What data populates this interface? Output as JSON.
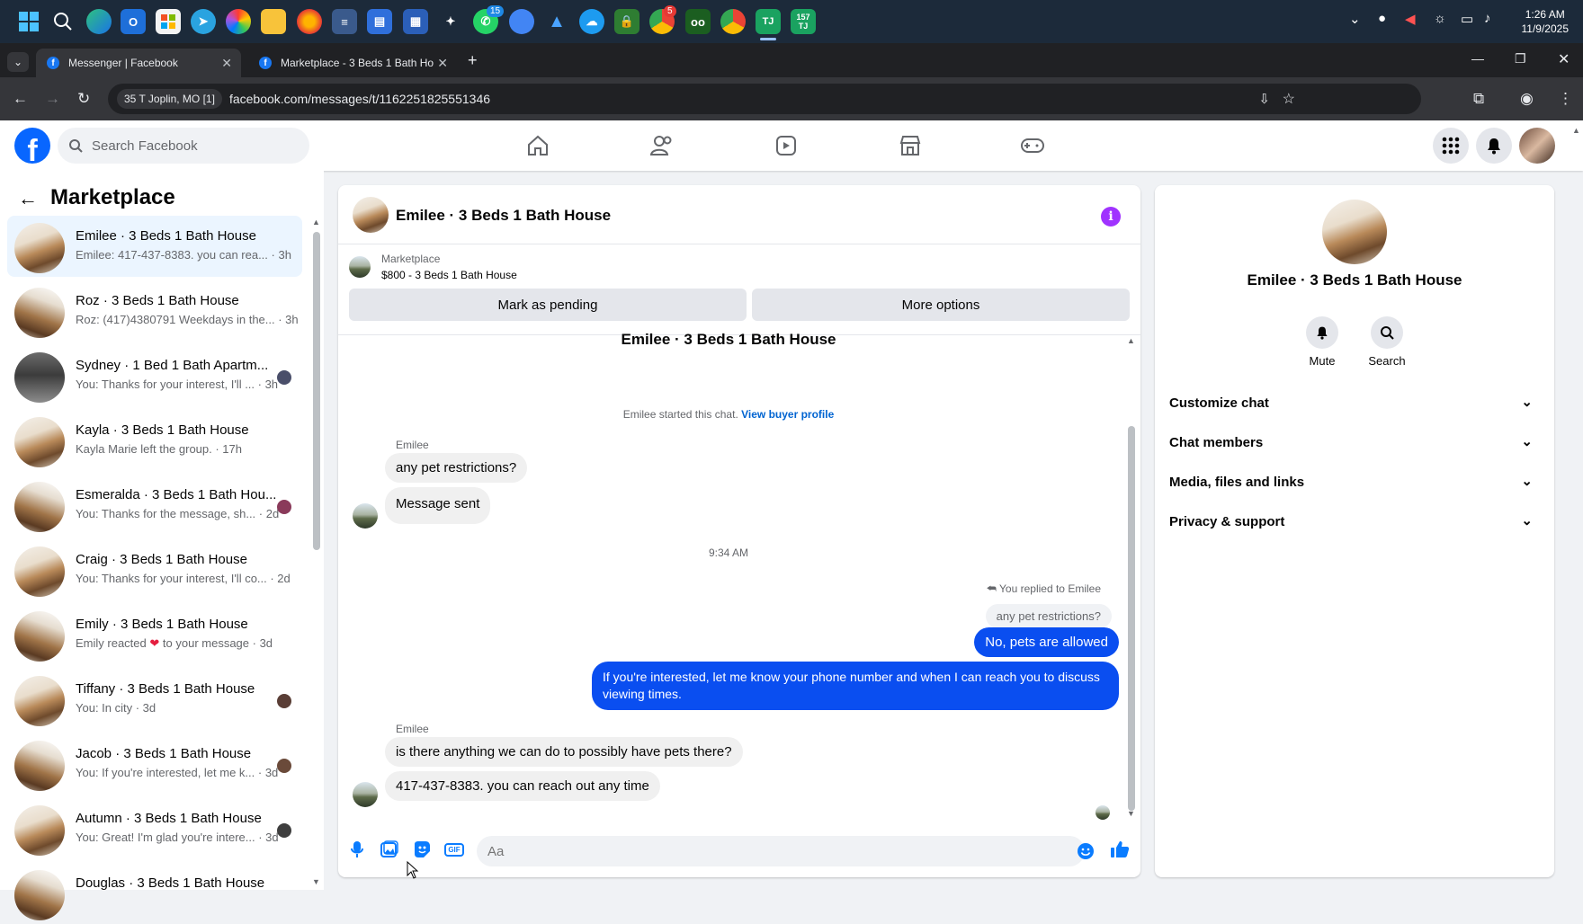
{
  "taskbar": {
    "badge_whatsapp": "15",
    "badge_chrome": "5",
    "badge_tj": "157",
    "time": "1:26 AM",
    "date": "11/9/2025"
  },
  "browser": {
    "tabs": [
      {
        "title": "Messenger | Facebook"
      },
      {
        "title": "Marketplace - 3 Beds 1 Bath Ho"
      }
    ],
    "location_chip": "35 T Joplin, MO [1]",
    "url": "facebook.com/messages/t/1162251825551346"
  },
  "facebook": {
    "search_placeholder": "Search Facebook"
  },
  "left": {
    "title": "Marketplace",
    "conversations": [
      {
        "name": "Emilee · 3 Beds 1 Bath House",
        "preview": "Emilee: 417-437-8383. you can rea... · 3h",
        "selected": true
      },
      {
        "name": "Roz · 3 Beds 1 Bath House",
        "preview": "Roz: (417)4380791 Weekdays in the... · 3h"
      },
      {
        "name": "Sydney · 1 Bed 1 Bath Apartm...",
        "preview": "You: Thanks for your interest, I'll ... · 3h"
      },
      {
        "name": "Kayla · 3 Beds 1 Bath House",
        "preview": "Kayla Marie left the group. · 17h"
      },
      {
        "name": "Esmeralda · 3 Beds 1 Bath Hou...",
        "preview": "You: Thanks for the message, sh... · 2d"
      },
      {
        "name": "Craig · 3 Beds 1 Bath House",
        "preview": "You: Thanks for your interest, I'll co... · 2d"
      },
      {
        "name": "Emily · 3 Beds 1 Bath House",
        "preview_a": "Emily reacted",
        "preview_b": "to your message · 3d"
      },
      {
        "name": "Tiffany · 3 Beds 1 Bath House",
        "preview": "You: In city · 3d"
      },
      {
        "name": "Jacob · 3 Beds 1 Bath House",
        "preview": "You: If you're interested, let me k... · 3d"
      },
      {
        "name": "Autumn · 3 Beds 1 Bath House",
        "preview": "You: Great! I'm glad you're intere... · 3d"
      },
      {
        "name": "Douglas · 3 Beds 1 Bath House",
        "preview": ""
      }
    ]
  },
  "chat": {
    "title": "Emilee · 3 Beds 1 Bath House",
    "marketplace_label": "Marketplace",
    "listing": "$800 - 3 Beds 1 Bath House",
    "btn_pending": "Mark as pending",
    "btn_more": "More options",
    "header_name": "Emilee · 3 Beds 1 Bath House",
    "started_text": "Emilee started this chat.",
    "view_profile": "View buyer profile",
    "sender1": "Emilee",
    "msg1": "any pet restrictions?",
    "msg2": "Message sent",
    "time": "9:34 AM",
    "replied_to": "You replied to Emilee",
    "quoted": "any pet restrictions?",
    "out1": "No, pets are allowed",
    "out2": "If you're interested, let me know your phone number and when I can reach you to discuss viewing times.",
    "sender2": "Emilee",
    "msg3": "is there anything we can do to possibly have pets there?",
    "msg4": "417-437-8383. you can reach out any time",
    "composer_placeholder": "Aa"
  },
  "right": {
    "name": "Emilee · 3 Beds 1 Bath House",
    "mute": "Mute",
    "search": "Search",
    "sections": [
      "Customize chat",
      "Chat members",
      "Media, files and links",
      "Privacy & support"
    ]
  },
  "colors": {
    "fb_blue": "#0866ff",
    "outgoing_bubble": "#0a4ef0",
    "selected_row": "#ebf5ff",
    "info_purple": "#a033ff"
  }
}
